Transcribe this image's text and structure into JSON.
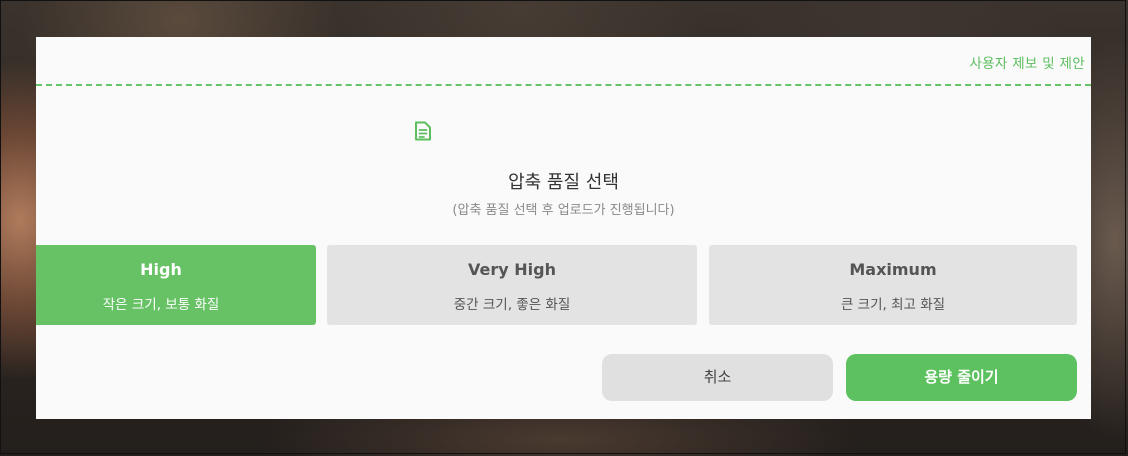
{
  "modal": {
    "report_link": "사용자 제보 및 제안",
    "icon": "document-icon",
    "title": "압축 품질 선택",
    "subtitle": "(압축 품질 선택 후 업로드가 진행됩니다)"
  },
  "options": [
    {
      "title": "High",
      "desc": "작은 크기, 보통 화질",
      "selected": true
    },
    {
      "title": "Very High",
      "desc": "중간 크기, 좋은 화질",
      "selected": false
    },
    {
      "title": "Maximum",
      "desc": "큰 크기, 최고 화질",
      "selected": false
    }
  ],
  "buttons": {
    "cancel": "취소",
    "confirm": "용량 줄이기"
  },
  "colors": {
    "accent": "#66c265",
    "option_bg": "#e3e3e3",
    "modal_bg": "#fafafa"
  }
}
